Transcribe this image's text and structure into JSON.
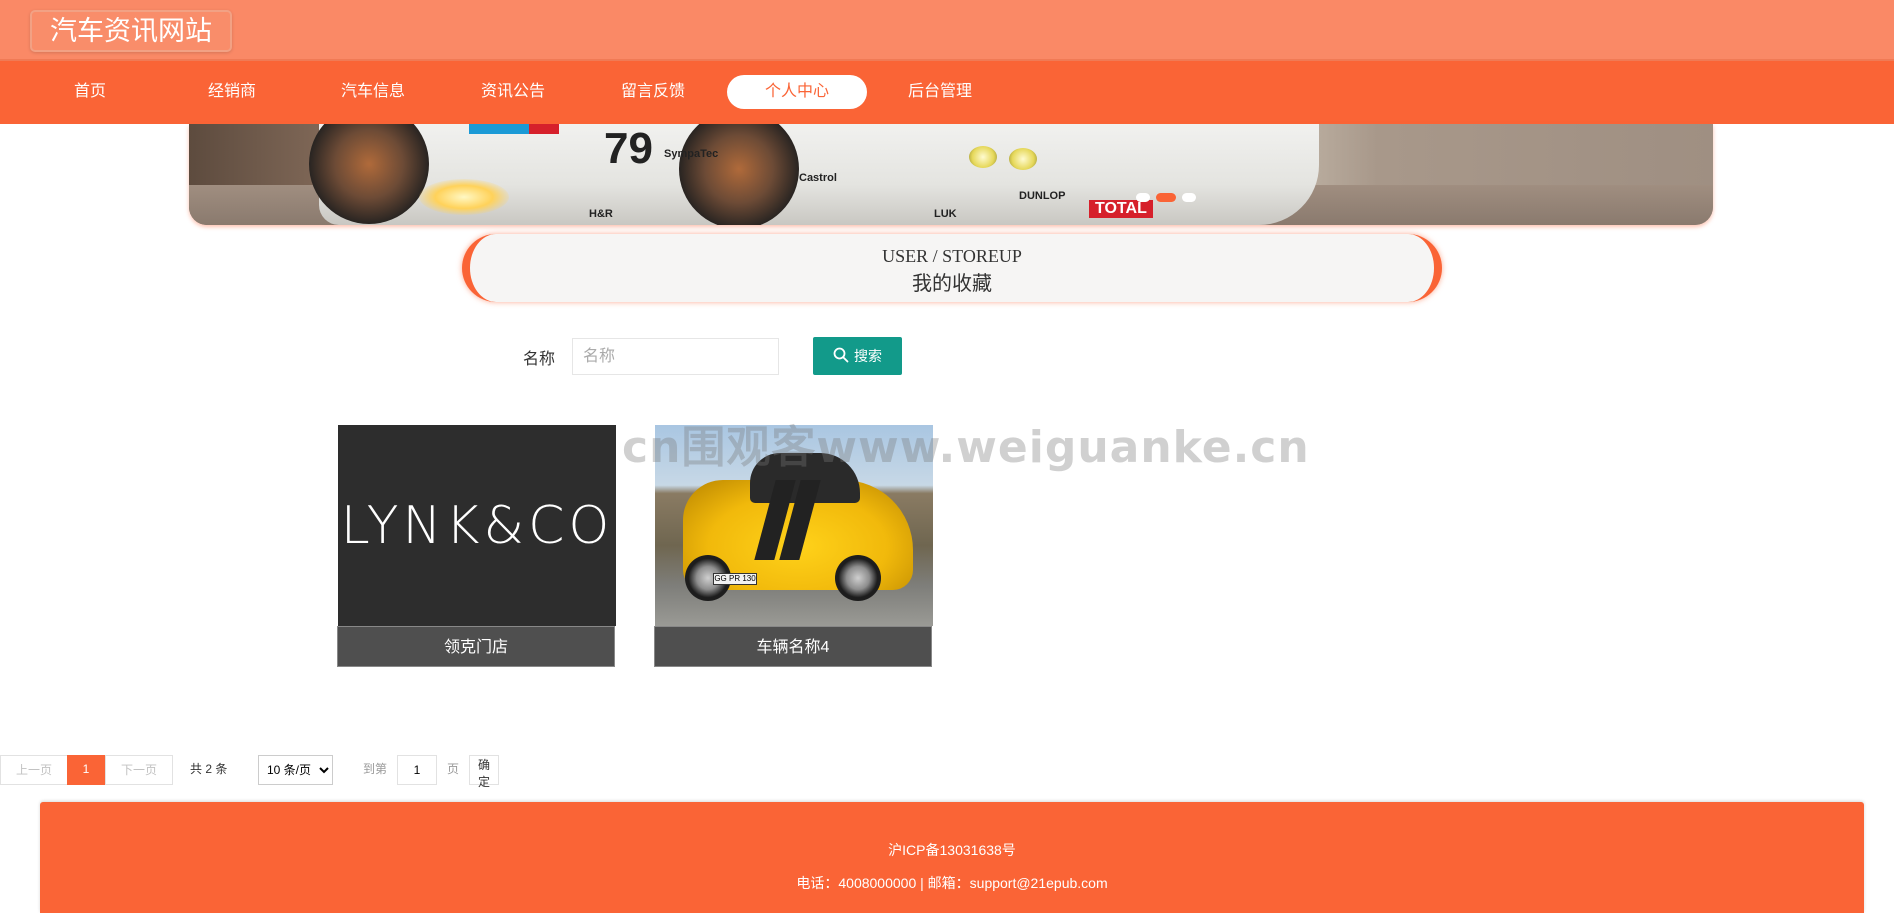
{
  "site": {
    "title": "汽车资讯网站"
  },
  "nav": {
    "items": [
      {
        "label": "首页",
        "active": false
      },
      {
        "label": "经销商",
        "active": false
      },
      {
        "label": "汽车信息",
        "active": false
      },
      {
        "label": "资讯公告",
        "active": false
      },
      {
        "label": "留言反馈",
        "active": false
      },
      {
        "label": "个人中心",
        "active": true
      },
      {
        "label": "后台管理",
        "active": false
      }
    ]
  },
  "banner": {
    "car_number": "79",
    "sponsors": [
      "Castrol",
      "DUNLOP",
      "TOTAL",
      "LUK",
      "H&R",
      "SympaTec"
    ],
    "active_slide": 1
  },
  "section": {
    "title_en": "USER / STOREUP",
    "title_cn": "我的收藏"
  },
  "search": {
    "label": "名称",
    "placeholder": "名称",
    "value": "",
    "button_label": "搜索",
    "button_icon": "search-icon"
  },
  "items": [
    {
      "name": "领克门店",
      "image_logo_text": "LYNK&CO"
    },
    {
      "name": "车辆名称4",
      "image_plate_text": "GG PR 130"
    }
  ],
  "watermark": "cn围观客www.weiguanke.cn",
  "pagination": {
    "prev": "上一页",
    "current": "1",
    "next": "下一页",
    "total": "共 2 条",
    "page_size": "10 条/页",
    "goto_label": "到第",
    "goto_value": "1",
    "page_suffix": "页",
    "confirm": "确定"
  },
  "footer": {
    "icp": "沪ICP备13031638号",
    "contact": "电话：4008000000 | 邮箱：support@21epub.com"
  },
  "colors": {
    "primary": "#fa6436",
    "topbar": "#fa8966",
    "search_button": "#129a8a",
    "caption_bg": "#4f4f4f"
  }
}
